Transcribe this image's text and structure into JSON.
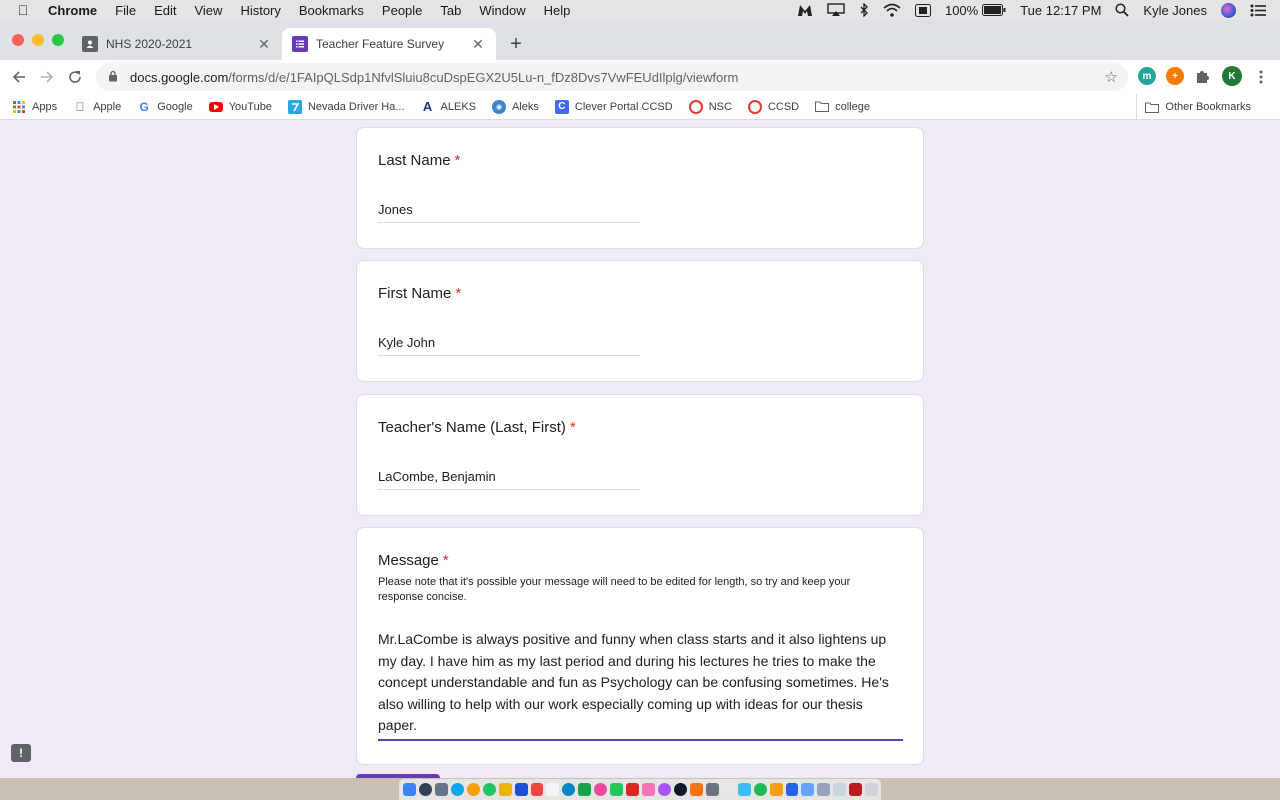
{
  "menubar": {
    "app": "Chrome",
    "items": [
      "File",
      "Edit",
      "View",
      "History",
      "Bookmarks",
      "People",
      "Tab",
      "Window",
      "Help"
    ],
    "battery": "100%",
    "clock": "Tue 12:17 PM",
    "user": "Kyle Jones"
  },
  "tabs": [
    {
      "title": "NHS 2020-2021",
      "active": false
    },
    {
      "title": "Teacher Feature Survey",
      "active": true
    }
  ],
  "omnibox": {
    "host": "docs.google.com",
    "path": "/forms/d/e/1FAIpQLSdp1NfvlSluiu8cuDspEGX2U5Lu-n_fDz8Dvs7VwFEUdIlplg/viewform"
  },
  "profile_initial": "K",
  "bookmarks": [
    "Apps",
    "Apple",
    "Google",
    "YouTube",
    "Nevada Driver Ha...",
    "ALEKS",
    "Aleks",
    "Clever Portal CCSD",
    "NSC",
    "CCSD",
    "college"
  ],
  "other_bookmarks": "Other Bookmarks",
  "form": {
    "last_name": {
      "label": "Last Name",
      "value": "Jones"
    },
    "first_name": {
      "label": "First Name",
      "value": "Kyle John"
    },
    "teacher_name": {
      "label": "Teacher's Name (Last, First)",
      "value": "LaCombe, Benjamin"
    },
    "message": {
      "label": "Message",
      "description": "Please note that it's possible your message will need to be edited for length, so try and keep your response concise.",
      "value": "Mr.LaCombe is always positive and funny when class starts and it also lightens up my day. I have him as my last period and during his lectures he tries to make the concept understandable and fun as Psychology can be confusing sometimes. He's also willing to help with our work especially coming up with ideas for our thesis paper."
    },
    "required_mark": "*"
  },
  "colors": {
    "form_accent": "#673ab7",
    "required": "#d93025",
    "page_bg": "#efeaf6"
  }
}
